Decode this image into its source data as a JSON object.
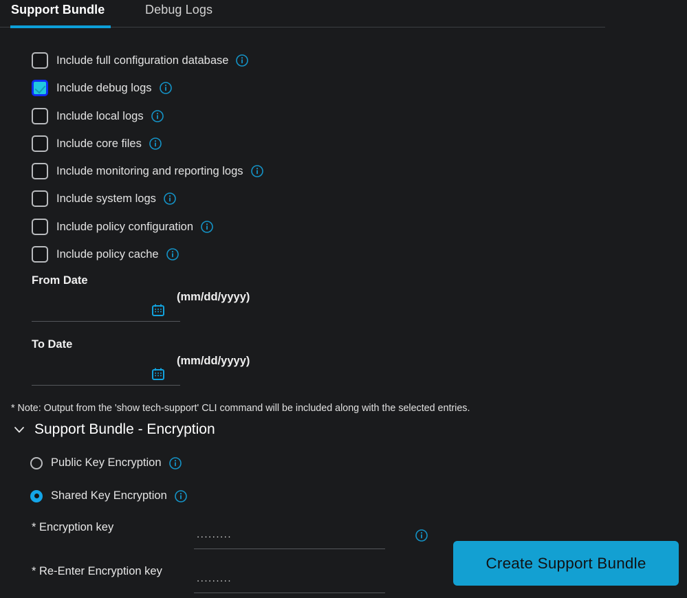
{
  "colors": {
    "background": "#1a1b1d",
    "accent": "#0d9fd8",
    "accent_button": "#13a0d2",
    "checkbox_checked_fill": "#21c7e0",
    "checkbox_focus_ring": "#0d2df5",
    "radio_selected": "#14a5e8",
    "info_icon": "#1494c8",
    "text_primary": "#e8e8e8",
    "divider": "#3d4044"
  },
  "tabs": [
    {
      "label": "Support Bundle",
      "active": true
    },
    {
      "label": "Debug Logs",
      "active": false
    }
  ],
  "checkboxes": [
    {
      "label": "Include full configuration database",
      "checked": false,
      "info": "info-icon"
    },
    {
      "label": "Include debug logs",
      "checked": true,
      "info": "info-icon"
    },
    {
      "label": "Include local logs",
      "checked": false,
      "info": "info-icon"
    },
    {
      "label": "Include core files",
      "checked": false,
      "info": "info-icon"
    },
    {
      "label": "Include monitoring and reporting logs",
      "checked": false,
      "info": "info-icon"
    },
    {
      "label": "Include system logs",
      "checked": false,
      "info": "info-icon"
    },
    {
      "label": "Include policy configuration",
      "checked": false,
      "info": "info-icon"
    },
    {
      "label": "Include policy cache",
      "checked": false,
      "info": "info-icon"
    }
  ],
  "dates": {
    "from": {
      "label": "From Date",
      "value": "",
      "placeholder": "",
      "format_hint": "(mm/dd/yyyy)",
      "calendar_icon": "calendar-icon"
    },
    "to": {
      "label": "To Date",
      "value": "",
      "placeholder": "",
      "format_hint": "(mm/dd/yyyy)",
      "calendar_icon": "calendar-icon"
    }
  },
  "note": "* Note: Output from the 'show tech-support' CLI command will be included along with the selected entries.",
  "encryption_section": {
    "title": "Support Bundle - Encryption",
    "expanded": true,
    "chevron_icon": "chevron-down-icon",
    "radios": [
      {
        "label": "Public Key Encryption",
        "selected": false,
        "info": "info-icon"
      },
      {
        "label": "Shared Key Encryption",
        "selected": true,
        "info": "info-icon"
      }
    ],
    "fields": [
      {
        "label": "* Encryption key",
        "value": ".........",
        "placeholder": ".........",
        "has_info": true
      },
      {
        "label": "* Re-Enter Encryption key",
        "value": ".........",
        "placeholder": ".........",
        "has_info": false
      }
    ]
  },
  "actions": {
    "create_bundle_label": "Create Support Bundle"
  }
}
